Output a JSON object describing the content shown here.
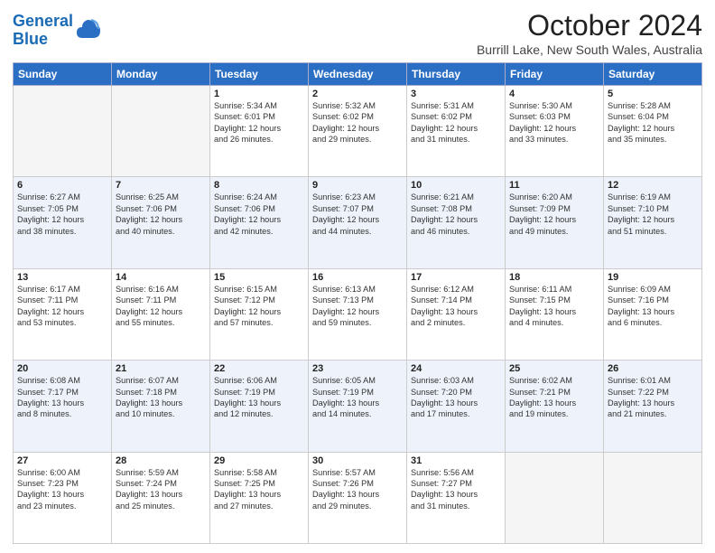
{
  "header": {
    "logo_line1": "General",
    "logo_line2": "Blue",
    "month_title": "October 2024",
    "location": "Burrill Lake, New South Wales, Australia"
  },
  "weekdays": [
    "Sunday",
    "Monday",
    "Tuesday",
    "Wednesday",
    "Thursday",
    "Friday",
    "Saturday"
  ],
  "weeks": [
    [
      {
        "day": "",
        "info": ""
      },
      {
        "day": "",
        "info": ""
      },
      {
        "day": "1",
        "info": "Sunrise: 5:34 AM\nSunset: 6:01 PM\nDaylight: 12 hours\nand 26 minutes."
      },
      {
        "day": "2",
        "info": "Sunrise: 5:32 AM\nSunset: 6:02 PM\nDaylight: 12 hours\nand 29 minutes."
      },
      {
        "day": "3",
        "info": "Sunrise: 5:31 AM\nSunset: 6:02 PM\nDaylight: 12 hours\nand 31 minutes."
      },
      {
        "day": "4",
        "info": "Sunrise: 5:30 AM\nSunset: 6:03 PM\nDaylight: 12 hours\nand 33 minutes."
      },
      {
        "day": "5",
        "info": "Sunrise: 5:28 AM\nSunset: 6:04 PM\nDaylight: 12 hours\nand 35 minutes."
      }
    ],
    [
      {
        "day": "6",
        "info": "Sunrise: 6:27 AM\nSunset: 7:05 PM\nDaylight: 12 hours\nand 38 minutes."
      },
      {
        "day": "7",
        "info": "Sunrise: 6:25 AM\nSunset: 7:06 PM\nDaylight: 12 hours\nand 40 minutes."
      },
      {
        "day": "8",
        "info": "Sunrise: 6:24 AM\nSunset: 7:06 PM\nDaylight: 12 hours\nand 42 minutes."
      },
      {
        "day": "9",
        "info": "Sunrise: 6:23 AM\nSunset: 7:07 PM\nDaylight: 12 hours\nand 44 minutes."
      },
      {
        "day": "10",
        "info": "Sunrise: 6:21 AM\nSunset: 7:08 PM\nDaylight: 12 hours\nand 46 minutes."
      },
      {
        "day": "11",
        "info": "Sunrise: 6:20 AM\nSunset: 7:09 PM\nDaylight: 12 hours\nand 49 minutes."
      },
      {
        "day": "12",
        "info": "Sunrise: 6:19 AM\nSunset: 7:10 PM\nDaylight: 12 hours\nand 51 minutes."
      }
    ],
    [
      {
        "day": "13",
        "info": "Sunrise: 6:17 AM\nSunset: 7:11 PM\nDaylight: 12 hours\nand 53 minutes."
      },
      {
        "day": "14",
        "info": "Sunrise: 6:16 AM\nSunset: 7:11 PM\nDaylight: 12 hours\nand 55 minutes."
      },
      {
        "day": "15",
        "info": "Sunrise: 6:15 AM\nSunset: 7:12 PM\nDaylight: 12 hours\nand 57 minutes."
      },
      {
        "day": "16",
        "info": "Sunrise: 6:13 AM\nSunset: 7:13 PM\nDaylight: 12 hours\nand 59 minutes."
      },
      {
        "day": "17",
        "info": "Sunrise: 6:12 AM\nSunset: 7:14 PM\nDaylight: 13 hours\nand 2 minutes."
      },
      {
        "day": "18",
        "info": "Sunrise: 6:11 AM\nSunset: 7:15 PM\nDaylight: 13 hours\nand 4 minutes."
      },
      {
        "day": "19",
        "info": "Sunrise: 6:09 AM\nSunset: 7:16 PM\nDaylight: 13 hours\nand 6 minutes."
      }
    ],
    [
      {
        "day": "20",
        "info": "Sunrise: 6:08 AM\nSunset: 7:17 PM\nDaylight: 13 hours\nand 8 minutes."
      },
      {
        "day": "21",
        "info": "Sunrise: 6:07 AM\nSunset: 7:18 PM\nDaylight: 13 hours\nand 10 minutes."
      },
      {
        "day": "22",
        "info": "Sunrise: 6:06 AM\nSunset: 7:19 PM\nDaylight: 13 hours\nand 12 minutes."
      },
      {
        "day": "23",
        "info": "Sunrise: 6:05 AM\nSunset: 7:19 PM\nDaylight: 13 hours\nand 14 minutes."
      },
      {
        "day": "24",
        "info": "Sunrise: 6:03 AM\nSunset: 7:20 PM\nDaylight: 13 hours\nand 17 minutes."
      },
      {
        "day": "25",
        "info": "Sunrise: 6:02 AM\nSunset: 7:21 PM\nDaylight: 13 hours\nand 19 minutes."
      },
      {
        "day": "26",
        "info": "Sunrise: 6:01 AM\nSunset: 7:22 PM\nDaylight: 13 hours\nand 21 minutes."
      }
    ],
    [
      {
        "day": "27",
        "info": "Sunrise: 6:00 AM\nSunset: 7:23 PM\nDaylight: 13 hours\nand 23 minutes."
      },
      {
        "day": "28",
        "info": "Sunrise: 5:59 AM\nSunset: 7:24 PM\nDaylight: 13 hours\nand 25 minutes."
      },
      {
        "day": "29",
        "info": "Sunrise: 5:58 AM\nSunset: 7:25 PM\nDaylight: 13 hours\nand 27 minutes."
      },
      {
        "day": "30",
        "info": "Sunrise: 5:57 AM\nSunset: 7:26 PM\nDaylight: 13 hours\nand 29 minutes."
      },
      {
        "day": "31",
        "info": "Sunrise: 5:56 AM\nSunset: 7:27 PM\nDaylight: 13 hours\nand 31 minutes."
      },
      {
        "day": "",
        "info": ""
      },
      {
        "day": "",
        "info": ""
      }
    ]
  ]
}
